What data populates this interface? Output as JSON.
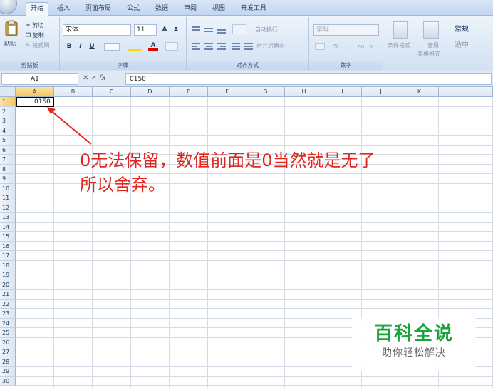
{
  "tabs": [
    "开始",
    "插入",
    "页面布局",
    "公式",
    "数据",
    "审阅",
    "视图",
    "开发工具"
  ],
  "clipboard": {
    "paste": "粘贴",
    "cut": "剪切",
    "copy": "复制",
    "format_painter": "格式刷",
    "label": "剪贴板"
  },
  "font": {
    "name": "宋体",
    "size": "11",
    "bold": "B",
    "italic": "I",
    "underline": "U",
    "label": "字体"
  },
  "alignment": {
    "wrap": "自动换行",
    "merge": "合并后居中",
    "label": "对齐方式"
  },
  "number": {
    "format": "常规",
    "percent": "%",
    "label": "数字"
  },
  "styles": {
    "conditional": "条件格式",
    "table_format_line1": "套用",
    "table_format_line2": "表格格式",
    "cell_style_1": "常规",
    "cell_style_2": "适中"
  },
  "formula_bar": {
    "cell_ref": "A1",
    "cancel": "✕",
    "enter": "✓",
    "fx": "fx",
    "content": "0150"
  },
  "columns": [
    "A",
    "B",
    "C",
    "D",
    "E",
    "F",
    "G",
    "H",
    "I",
    "J",
    "K",
    "L"
  ],
  "rows": [
    "1",
    "2",
    "3",
    "4",
    "5",
    "6",
    "7",
    "8",
    "9",
    "10",
    "11",
    "12",
    "13",
    "14",
    "15",
    "16",
    "17",
    "18",
    "19",
    "20",
    "21",
    "22",
    "23",
    "24",
    "25",
    "26",
    "27",
    "28",
    "29",
    "30"
  ],
  "cell_a1": "0150",
  "annotation": {
    "line1": "0无法保留，数值前面是0当然就是无了",
    "line2": "所以舍弃。"
  },
  "watermark": {
    "title": "百科全说",
    "subtitle": "助你轻松解决"
  }
}
